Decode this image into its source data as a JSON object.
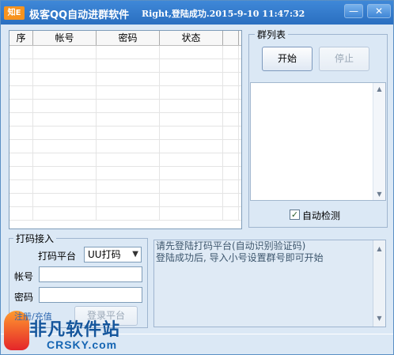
{
  "window": {
    "app_icon_text": "知E",
    "title": "极客QQ自动进群软件",
    "status_title": "Right,登陆成功.2015-9-10 11:47:32",
    "minimize_label": "—",
    "close_label": "✕"
  },
  "account_table": {
    "columns": [
      "序",
      "帐号",
      "密码",
      "状态"
    ],
    "rows": []
  },
  "group_list": {
    "title": "群列表",
    "start_label": "开始",
    "stop_label": "停止",
    "auto_detect_label": "自动检测",
    "auto_detect_checked": true
  },
  "captcha_platform": {
    "title": "打码接入",
    "platform_label": "打码平台",
    "platform_value": "UU打码",
    "account_label": "帐号",
    "account_value": "",
    "password_label": "密码",
    "password_value": "",
    "login_label": "登录平台",
    "register_link": "注册/充值"
  },
  "log": {
    "lines": [
      "请先登陆打码平台(自动识别验证码)",
      "登陆成功后, 导入小号设置群号即可开始"
    ]
  },
  "watermark": {
    "main_text": "非凡软件站",
    "sub_text": "CRSKY.com"
  },
  "colors": {
    "title_bar": "#2f7fd6",
    "window_bg": "#dbe8f5",
    "watermark_blue": "#15569c",
    "watermark_orange": "#f7931e"
  }
}
